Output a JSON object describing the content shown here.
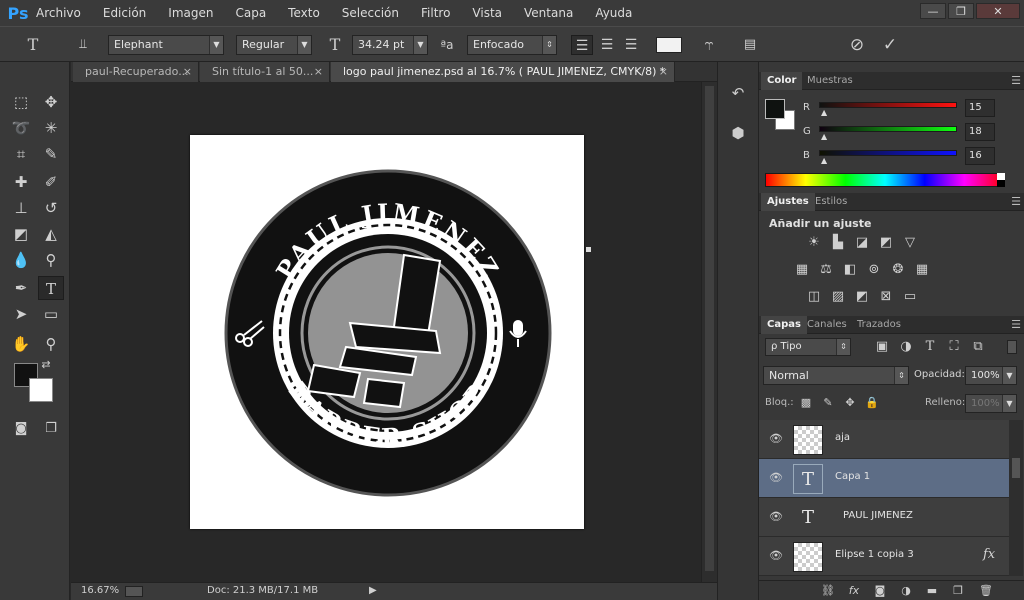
{
  "app": {
    "logo": "Ps"
  },
  "menu": [
    "Archivo",
    "Edición",
    "Imagen",
    "Capa",
    "Texto",
    "Selección",
    "Filtro",
    "Vista",
    "Ventana",
    "Ayuda"
  ],
  "window_controls": {
    "minimize": "—",
    "restore": "❐",
    "close": "✕"
  },
  "options": {
    "tool_icon": "T",
    "font_family": "Elephant",
    "font_style": "Regular",
    "font_size": "34.24 pt",
    "aa_label": "ªa",
    "antialias": "Enfocado",
    "cancel_icon": "⃠",
    "commit_icon": "✓"
  },
  "tabs": [
    {
      "label": "paul-Recuperado...",
      "close": "×"
    },
    {
      "label": "Sin título-1 al 50...",
      "close": "×"
    },
    {
      "label": "logo paul jimenez.psd al 16.7% ( PAUL JIMENEZ, CMYK/8) *",
      "close": "×"
    }
  ],
  "logo_art": {
    "top_text": "PAUL JIMENEZ",
    "bottom_text": "BARBER SHOP",
    "colors": {
      "dark": "#111111",
      "light": "#ffffff"
    }
  },
  "status": {
    "zoom": "16.67%",
    "doc_info": "Doc: 21.3 MB/17.1 MB",
    "arrow": "▶"
  },
  "color_panel": {
    "tabs": [
      "Color",
      "Muestras"
    ],
    "channels": [
      {
        "label": "R",
        "value": "15",
        "color": "#e03030"
      },
      {
        "label": "G",
        "value": "18",
        "color": "#30c030"
      },
      {
        "label": "B",
        "value": "16",
        "color": "#3060e0"
      }
    ]
  },
  "adjust_panel": {
    "tabs": [
      "Ajustes",
      "Estilos"
    ],
    "title": "Añadir un ajuste"
  },
  "layers_panel": {
    "tabs": [
      "Capas",
      "Canales",
      "Trazados"
    ],
    "filter_label": "ρ Tipo",
    "blend_mode": "Normal",
    "opacity_label": "Opacidad:",
    "opacity_value": "100%",
    "lock_label": "Bloq.:",
    "fill_label": "Relleno:",
    "fill_value": "100%",
    "layers": [
      {
        "name": "aja",
        "type": "image",
        "selected": false
      },
      {
        "name": "Capa 1",
        "type": "text",
        "selected": true
      },
      {
        "name": "PAUL JIMENEZ",
        "type": "text",
        "selected": false
      },
      {
        "name": "Elipse 1 copia 3",
        "type": "shape",
        "selected": false,
        "fx": "fx"
      }
    ]
  }
}
